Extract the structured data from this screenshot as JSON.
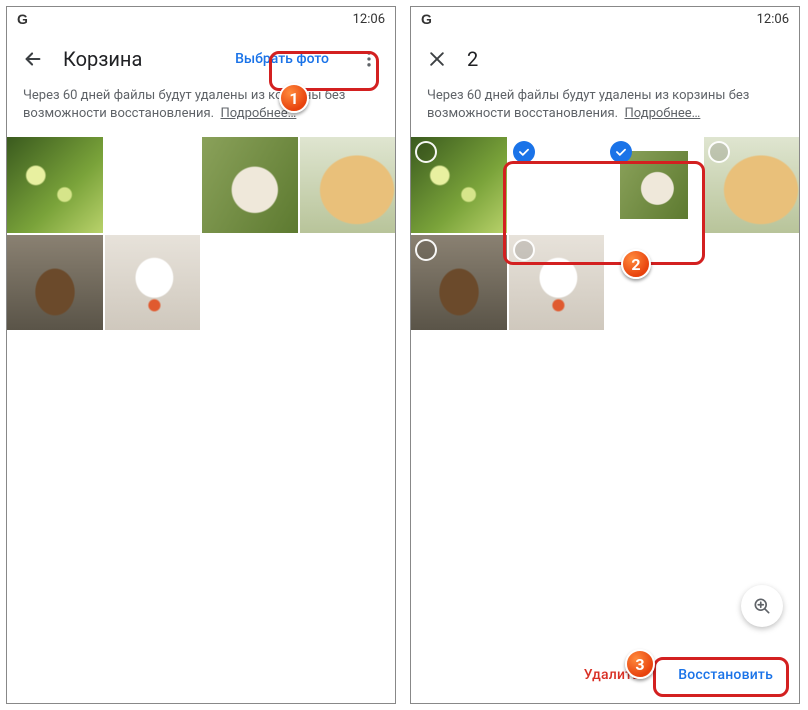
{
  "status": {
    "brand": "G",
    "time": "12:06"
  },
  "left": {
    "title": "Корзина",
    "select_label": "Выбрать фото",
    "notice_text": "Через 60 дней файлы будут удалены из корзины без возможности восстановления.",
    "notice_link": "Подробнее…",
    "thumbs": [
      {
        "name": "forest-bokeh"
      },
      {
        "name": "dogs-pair"
      },
      {
        "name": "guinea-pig"
      },
      {
        "name": "golden-retriever"
      },
      {
        "name": "monkey"
      },
      {
        "name": "hat-dog"
      }
    ]
  },
  "right": {
    "selected_count": "2",
    "notice_text": "Через 60 дней файлы будут удалены из корзины без возможности восстановления.",
    "notice_link": "Подробнее…",
    "thumbs": [
      {
        "name": "forest-bokeh",
        "selected": false
      },
      {
        "name": "dogs-pair",
        "selected": true
      },
      {
        "name": "guinea-pig",
        "selected": true
      },
      {
        "name": "golden-retriever",
        "selected": false
      },
      {
        "name": "monkey",
        "selected": false
      },
      {
        "name": "hat-dog",
        "selected": false
      }
    ],
    "delete_label": "Удалить",
    "restore_label": "Восстановить"
  },
  "annotations": {
    "step1": "1",
    "step2": "2",
    "step3": "3"
  }
}
